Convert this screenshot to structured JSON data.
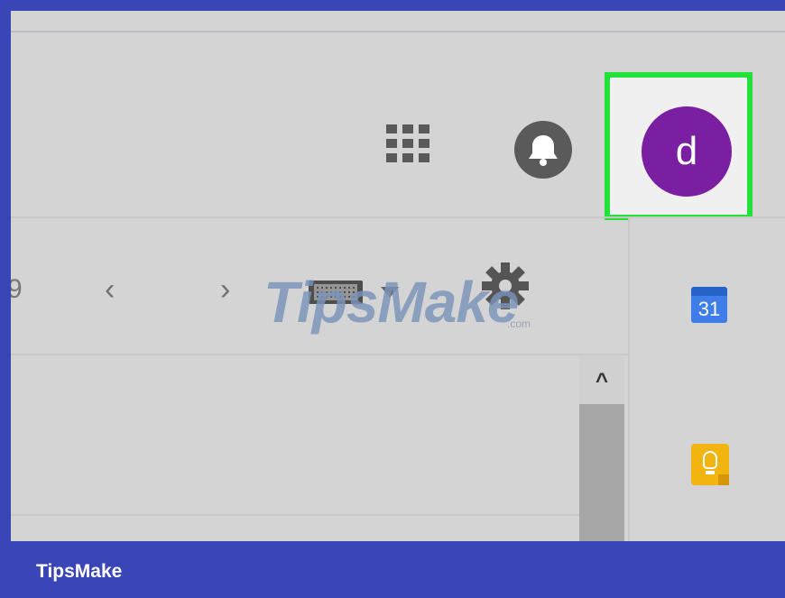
{
  "header": {
    "avatar_letter": "d",
    "avatar_color": "#7b1fa2",
    "highlight_color": "#22e23a",
    "icons": [
      "apps-grid-icon",
      "notifications-bell-icon"
    ]
  },
  "toolbar": {
    "left_fragment": "9",
    "prev_glyph": "‹",
    "next_glyph": "›",
    "icons": [
      "chevron-left-icon",
      "chevron-right-icon",
      "keyboard-icon",
      "dropdown-arrow-icon",
      "settings-gear-icon"
    ]
  },
  "side_panel": {
    "calendar_day": "31",
    "icons": [
      "google-calendar-icon",
      "google-keep-icon"
    ]
  },
  "scrollbar": {
    "up_glyph": "^"
  },
  "watermark": {
    "text": "TipsMake",
    "suffix": ".com"
  },
  "footer": {
    "brand": "TipsMake",
    "background": "#3a46b8"
  }
}
